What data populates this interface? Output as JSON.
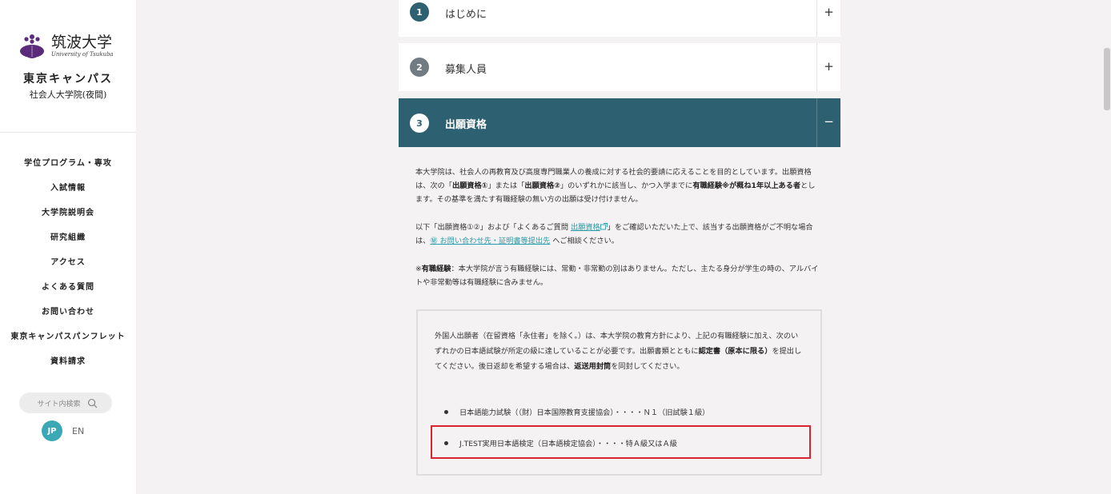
{
  "sidebar": {
    "logo_jp": "筑波大学",
    "logo_en": "University of Tsukuba",
    "campus_name": "東京キャンパス",
    "campus_sub": "社会人大学院(夜間)",
    "nav": [
      "学位プログラム・専攻",
      "入試情報",
      "大学院説明会",
      "研究組織",
      "アクセス",
      "よくある質問",
      "お問い合わせ",
      "東京キャンパスパンフレット",
      "資料請求"
    ],
    "search_placeholder": "サイト内検索",
    "lang_jp": "JP",
    "lang_en": "EN"
  },
  "accordion": [
    {
      "num": "1",
      "title": "はじめに",
      "toggle": "+"
    },
    {
      "num": "2",
      "title": "募集人員",
      "toggle": "+"
    },
    {
      "num": "3",
      "title": "出願資格",
      "toggle": "−"
    }
  ],
  "content": {
    "p1_a": "本大学院は、社会人の再教育及び高度専門職業人の養成に対する社会的要請に応えることを目的としています。出願資格は、次の「",
    "p1_b": "出願資格①",
    "p1_c": "」または「",
    "p1_d": "出願資格②",
    "p1_e": "」のいずれかに該当し、かつ入学までに",
    "p1_f": "有職経験※が概ね1年以上ある者",
    "p1_g": "とします。その基準を満たす有職経験の無い方の出願は受け付けません。",
    "p2_a": "以下「出願資格①②」および「よくあるご質問 ",
    "p2_link1": "出願資格",
    "p2_b": "」をご確認いただいた上で、該当する出願資格がご不明な場合は、",
    "p2_link2": "㊙ お問い合わせ先・証明書等提出先",
    "p2_c": " へご相談ください。",
    "p3_a": "※",
    "p3_b": "有職経験",
    "p3_c": "：本大学院が言う有職経験には、常勤・非常勤の別はありません。ただし、主たる身分が学生の時の、アルバイトや非常勤等は有職経験に含みません。",
    "box_a": "外国人出願者（在留資格「永住者」を除く。）は、本大学院の教育方針により、上記の有職経験に加え、次のいずれかの日本語試験が所定の級に達していることが必要です。出願書類とともに",
    "box_b": "認定書（原本に限る）",
    "box_c": "を提出してください。後日返却を希望する場合は、",
    "box_d": "返送用封筒",
    "box_e": "を同封してください。",
    "bullets": [
      "日本語能力試験（（財）日本国際教育支援協会）・・・・Ｎ１（旧試験１級）",
      "J.TEST実用日本語検定（日本語検定協会）・・・・特Ａ級又はＡ級"
    ]
  },
  "colors": {
    "accent": "#2d6070",
    "link": "#2b9aa8",
    "highlight": "#d9262e",
    "lang_badge": "#3aa8b5"
  }
}
